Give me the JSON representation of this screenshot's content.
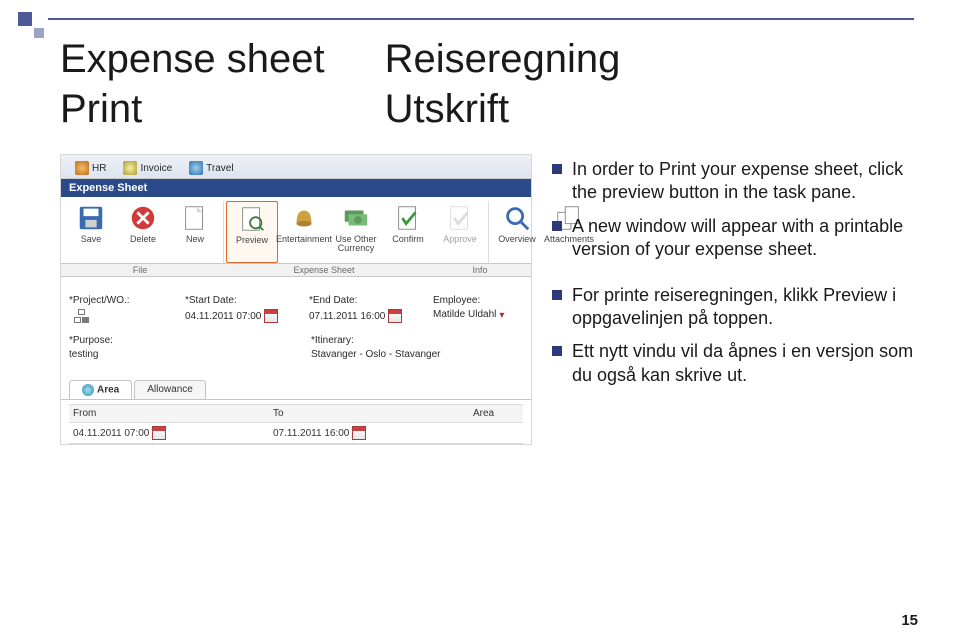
{
  "title_left_1": "Expense sheet",
  "title_left_2": "Print",
  "title_right_1": "Reiseregning",
  "title_right_2": "Utskrift",
  "bullets_en": [
    "In order to Print your expense sheet, click the preview button in the task pane.",
    "A new window will appear with a printable version of your expense sheet."
  ],
  "bullets_no": [
    "For printe reiseregningen, klikk Preview i oppgavelinjen på toppen.",
    "Ett nytt vindu vil da åpnes i en versjon som du også kan skrive ut."
  ],
  "page_number": "15",
  "ribbon": {
    "tab_hr": "HR",
    "tab_invoice": "Invoice",
    "tab_travel": "Travel"
  },
  "sidebar_header": "Expense Sheet",
  "toolbar": {
    "save": "Save",
    "delete": "Delete",
    "new": "New",
    "preview": "Preview",
    "entertainment": "Entertainment",
    "use_other": "Use Other\nCurrency",
    "confirm": "Confirm",
    "approve": "Approve",
    "overview": "Overview",
    "attachments": "Attachments"
  },
  "groups": {
    "file": "File",
    "expense": "Expense Sheet",
    "info": "Info"
  },
  "form": {
    "project_label": "*Project/WO.:",
    "project_val": "",
    "start_label": "*Start Date:",
    "start_val": "04.11.2011 07:00",
    "end_label": "*End Date:",
    "end_val": "07.11.2011 16:00",
    "employee_label": "Employee:",
    "employee_val": "Matilde Uldahl",
    "purpose_label": "*Purpose:",
    "purpose_val": "testing",
    "itinerary_label": "*Itinerary:",
    "itinerary_val": "Stavanger - Oslo - Stavanger"
  },
  "tabs2": {
    "area": "Area",
    "allowance": "Allowance"
  },
  "area": {
    "from": "From",
    "to": "To",
    "area_hdr": "Area",
    "from_val": "04.11.2011 07:00",
    "to_val": "07.11.2011 16:00"
  }
}
